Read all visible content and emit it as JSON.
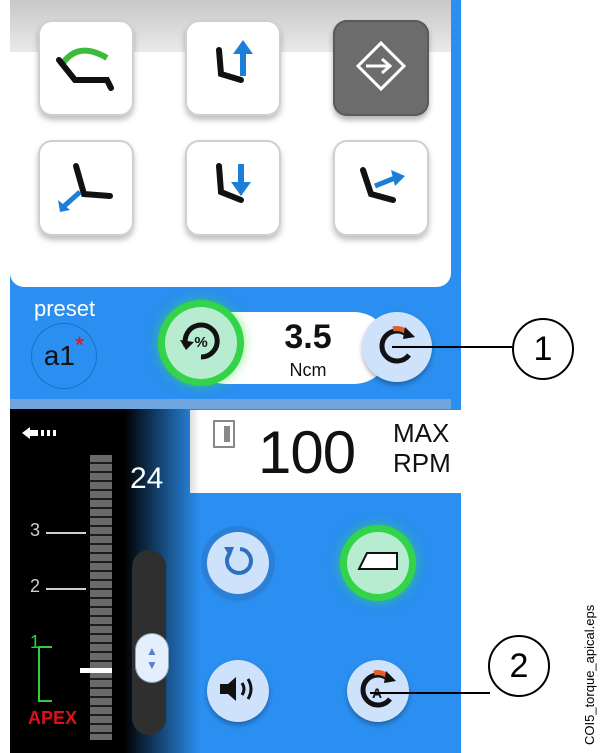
{
  "preset": {
    "label": "preset",
    "value": "a1",
    "marker": "*"
  },
  "torque": {
    "value": "3.5",
    "unit": "Ncm"
  },
  "speed": {
    "value": "100",
    "max_label": "MAX",
    "unit": "RPM"
  },
  "apex": {
    "count": "24",
    "marks": [
      "3",
      "2",
      "1"
    ],
    "label": "APEX",
    "level": 0.1
  },
  "callouts": [
    "1",
    "2"
  ],
  "caption": "COI5_torque_apical.eps",
  "colors": {
    "screen": "#2a8ff0",
    "active_glow": "#34d44a",
    "apex_red": "#e0101a"
  },
  "icons": {
    "positions_row1": [
      "chair-recline-icon",
      "chair-raise-icon",
      "return-position-icon"
    ],
    "positions_row2": [
      "chair-lower-back-icon",
      "chair-lower-icon",
      "chair-forward-icon"
    ],
    "torque": [
      "torque-percent-icon",
      "rotation-direction-icon"
    ],
    "controls": [
      "reverse-icon",
      "light-icon",
      "sound-icon",
      "auto-reverse-icon"
    ]
  }
}
